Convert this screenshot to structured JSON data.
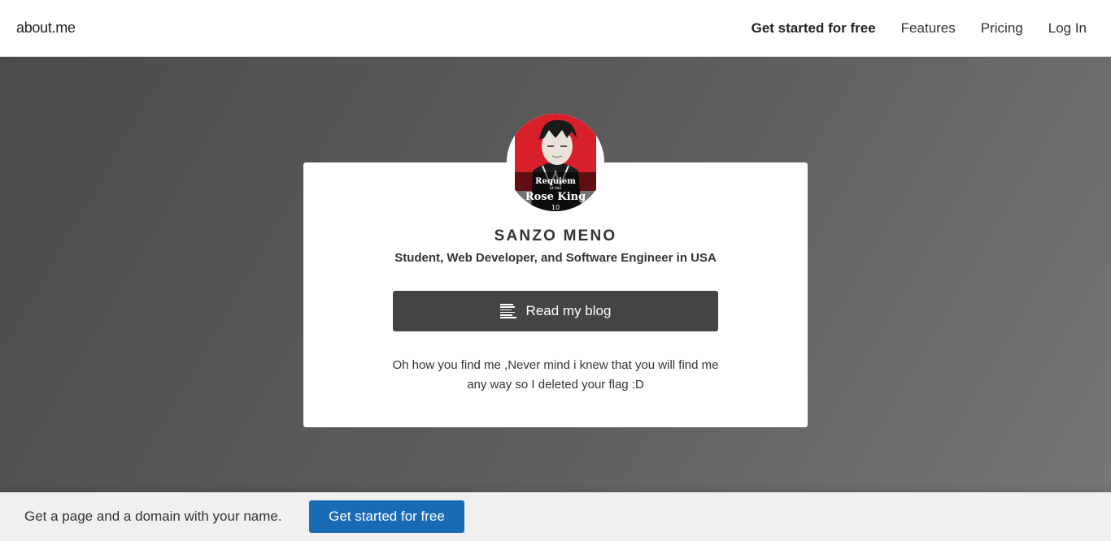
{
  "nav": {
    "logo": "about.me",
    "links": [
      "Get started for free",
      "Features",
      "Pricing",
      "Log In"
    ]
  },
  "profile": {
    "name": "SANZO MENO",
    "headline": "Student, Web Developer, and Software Engineer in USA",
    "cta_label": "Read my blog",
    "cta_icon": "document-lines-icon",
    "bio": "Oh how you find me ,Never mind i knew that you will find me any way so I deleted your flag :D",
    "avatar_text": {
      "line1": "Requiem",
      "line2": "of the",
      "line3": "Rose King",
      "volume": "10"
    }
  },
  "footer": {
    "text": "Get a page and a domain with your name.",
    "button": "Get started for free"
  },
  "colors": {
    "cta": "#444444",
    "footer_button": "#1a6bb5",
    "avatar_red": "#d8202a"
  }
}
